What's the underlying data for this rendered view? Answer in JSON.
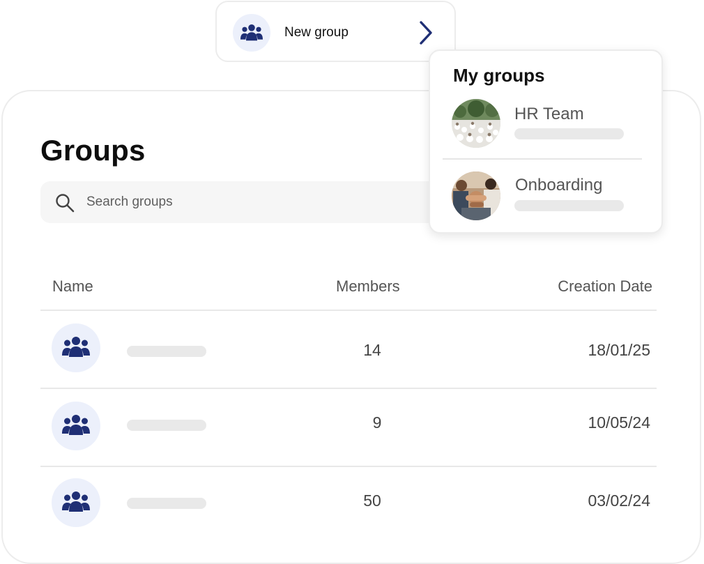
{
  "new_group": {
    "label": "New group",
    "icon": "group-icon"
  },
  "my_groups": {
    "title": "My groups",
    "items": [
      {
        "name": "HR Team"
      },
      {
        "name": "Onboarding"
      }
    ]
  },
  "groups_page": {
    "title": "Groups",
    "search": {
      "placeholder": "Search groups",
      "value": ""
    },
    "table": {
      "headers": {
        "name": "Name",
        "members": "Members",
        "creation_date": "Creation Date"
      },
      "rows": [
        {
          "members": "14",
          "creation_date": "18/01/25"
        },
        {
          "members": "9",
          "creation_date": "10/05/24"
        },
        {
          "members": "50",
          "creation_date": "03/02/24"
        }
      ]
    }
  },
  "colors": {
    "accent": "#1f2f75",
    "icon_bg": "#ecf0fb",
    "skeleton": "#e9e9e9",
    "border": "#ececec"
  }
}
